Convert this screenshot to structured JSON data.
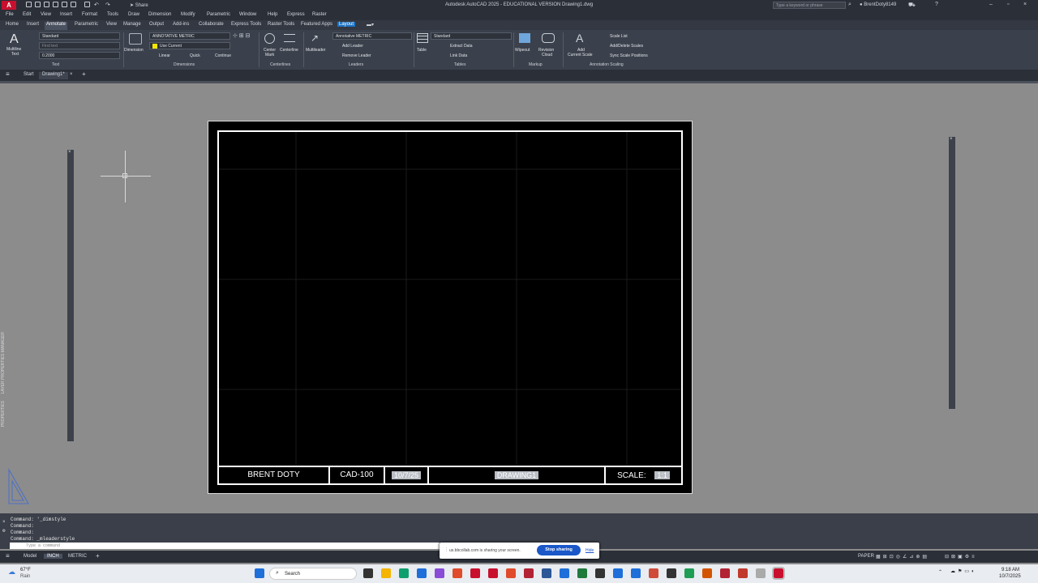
{
  "title": "Autodesk AutoCAD 2025 - EDUCATIONAL VERSION    Drawing1.dwg",
  "logo_text": "A",
  "quick_access": {
    "share_label": "Share"
  },
  "search": {
    "placeholder": "Type a keyword or phrase"
  },
  "user": {
    "name": "BrentDoty8149"
  },
  "menu": [
    "File",
    "Edit",
    "View",
    "Insert",
    "Format",
    "Tools",
    "Draw",
    "Dimension",
    "Modify",
    "Parametric",
    "Window",
    "Help",
    "Express",
    "Raster"
  ],
  "tabs": [
    "Home",
    "Insert",
    "Annotate",
    "Parametric",
    "View",
    "Manage",
    "Output",
    "Add-ins",
    "Collaborate",
    "Express Tools",
    "Raster Tools",
    "Featured Apps",
    "Layout"
  ],
  "active_tab": "Annotate",
  "ribbon": {
    "text": {
      "multiline": "Multiline",
      "text": "Text",
      "style": "Standard",
      "find": "Find text",
      "height": "0.2000",
      "panel": "Text"
    },
    "dimensions": {
      "dimension": "Dimension",
      "style": "ANNOTATIVE METRIC",
      "layer": "Use Current",
      "linear": "Linear",
      "quick": "Quick",
      "continue": "Continue",
      "panel": "Dimensions"
    },
    "centerlines": {
      "center": "Center",
      "mark": "Mark",
      "centerline": "Centerline",
      "panel": "Centerlines"
    },
    "leaders": {
      "multileader": "Multileader",
      "style": "Annotative METRIC",
      "add": "Add Leader",
      "remove": "Remove Leader",
      "panel": "Leaders"
    },
    "tables": {
      "table": "Table",
      "style": "Standard",
      "extract": "Extract Data",
      "link": "Link Data",
      "panel": "Tables"
    },
    "markup": {
      "wipeout": "Wipeout",
      "revision": "Revision",
      "cloud": "Cloud",
      "panel": "Markup"
    },
    "scaling": {
      "add": "Add",
      "current": "Current Scale",
      "list": "Scale List",
      "adddelete": "Add/Delete Scales",
      "sync": "Sync Scale Positions",
      "panel": "Annotation Scaling"
    }
  },
  "file_tabs": {
    "start": "Start",
    "drawing": "Drawing1*"
  },
  "title_block": {
    "name": "BRENT DOTY",
    "course": "CAD-100",
    "date": "10/7/25",
    "drawing": "DRAWING1",
    "scale_label": "SCALE:",
    "scale_value": "1:1"
  },
  "palettes": {
    "properties": "PROPERTIES",
    "layer": "LAYER PROPERTIES MANAGER"
  },
  "command_history": [
    "Command: '_dimstyle",
    "Command:",
    "Command:",
    "Command: _mleaderstyle"
  ],
  "command_placeholder": "Type a command",
  "share_bar": {
    "message": "us.bbcollab.com is sharing your screen.",
    "stop": "Stop sharing",
    "hide": "Hide"
  },
  "status": {
    "model": "Model",
    "inch": "INCH",
    "metric": "METRIC",
    "paper": "PAPER"
  },
  "taskbar": {
    "weather_temp": "67°F",
    "weather_desc": "Rain",
    "search": "Search",
    "time": "9:18 AM",
    "date": "10/7/2025"
  }
}
